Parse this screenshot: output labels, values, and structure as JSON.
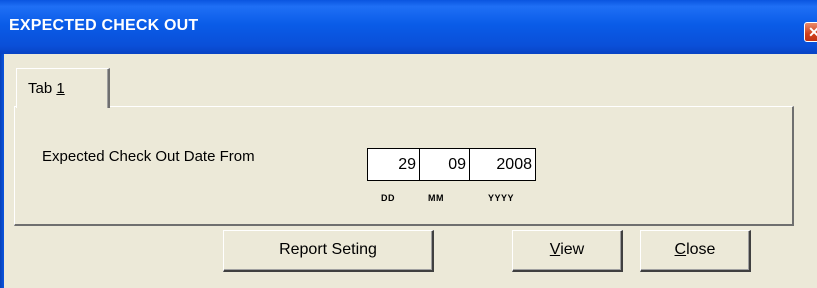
{
  "window": {
    "title": "EXPECTED CHECK OUT",
    "close_glyph": "✕"
  },
  "tabs": [
    {
      "label_prefix": "Tab ",
      "label_mnemonic": "1"
    }
  ],
  "form": {
    "date_label": "Expected Check Out Date From",
    "day": "29",
    "month": "09",
    "year": "2008",
    "day_hint": "DD",
    "month_hint": "MM",
    "year_hint": "YYYY"
  },
  "buttons": {
    "report_setting": "Report Seting",
    "view_mnemonic": "V",
    "view_rest": "iew",
    "close_mnemonic": "C",
    "close_rest": "lose"
  },
  "icons": {
    "close": "close-icon"
  },
  "colors": {
    "title_bar": "#0a55e0",
    "close_button": "#d0401c",
    "face": "#ece9d8"
  }
}
